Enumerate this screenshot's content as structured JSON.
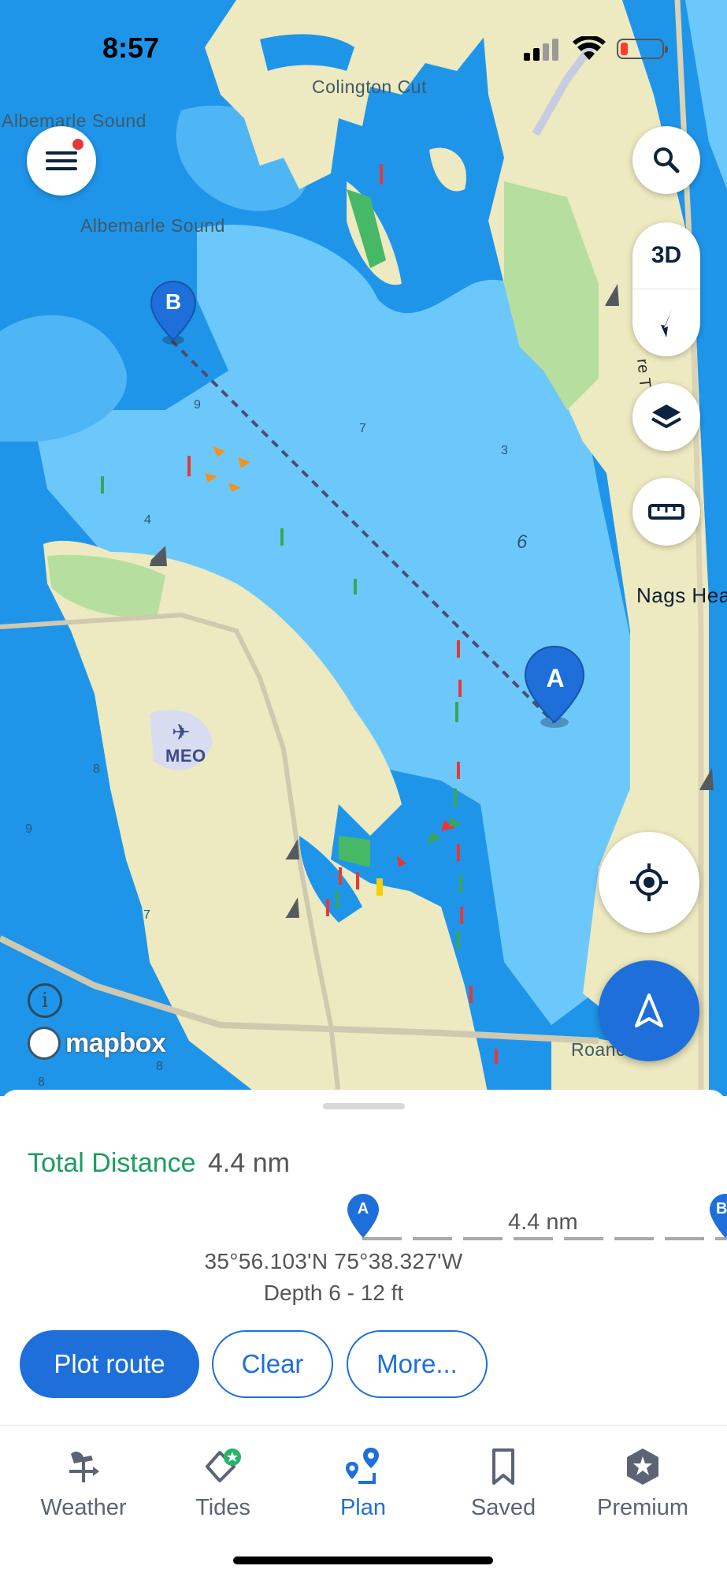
{
  "status_bar": {
    "time": "8:57"
  },
  "map": {
    "labels": {
      "albemarle_sound_1": "Albemarle Sound",
      "albemarle_sound_2": "Albemarle Sound",
      "colington_cut": "Colington Cut",
      "nags_head": "Nags Hea",
      "roanoke_sound": "Roano      und",
      "airport_code": "MEO",
      "shore_fragment": "re T"
    },
    "depth_soundings": [
      "9",
      "7",
      "3",
      "4",
      "6",
      "8",
      "9",
      "7",
      "8",
      "8"
    ],
    "route": {
      "start_pin": "A",
      "end_pin": "B"
    },
    "controls": {
      "menu_icon": "hamburger-menu-icon",
      "search_icon": "magnifier-icon",
      "view_mode": "3D",
      "compass_icon": "north-compass-icon",
      "layers_icon": "layers-icon",
      "ruler_icon": "ruler-icon",
      "locate_icon": "crosshair-icon",
      "navigate_icon": "navigation-arrow-icon"
    },
    "attribution": {
      "info_icon": "i",
      "logo_text": "mapbox"
    },
    "colors": {
      "water": "#1f95ea",
      "shallow": "#6cc8fb",
      "land": "#ede9c0",
      "green_land": "#b6df9f",
      "accent": "#1e6fd9",
      "route_line": "#4b4d6e"
    }
  },
  "sheet": {
    "total_label": "Total Distance",
    "total_value": "4.4 nm",
    "segment_start": "A",
    "segment_end": "B",
    "segment_distance": "4.4 nm",
    "coordinates": "35°56.103'N  75°38.327'W",
    "depth": "Depth 6 - 12 ft",
    "buttons": {
      "plot": "Plot route",
      "clear": "Clear",
      "more": "More..."
    }
  },
  "tabs": [
    {
      "label": "Weather",
      "icon": "weather-vane-icon",
      "active": false
    },
    {
      "label": "Tides",
      "icon": "tides-badge-icon",
      "active": false
    },
    {
      "label": "Plan",
      "icon": "plan-route-icon",
      "active": true
    },
    {
      "label": "Saved",
      "icon": "bookmark-icon",
      "active": false
    },
    {
      "label": "Premium",
      "icon": "premium-star-icon",
      "active": false
    }
  ]
}
